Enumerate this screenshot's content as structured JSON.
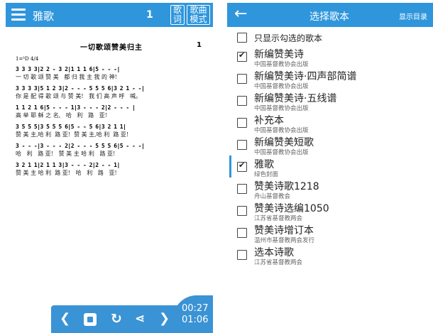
{
  "left": {
    "title": "雅歌",
    "page": "1",
    "lyrics_button": "歌词",
    "mode_button": "歌曲模式",
    "score": {
      "title": "一切歌颂赞美归主",
      "number": "1",
      "key": "1=ᵇD 4/4",
      "rows": [
        {
          "notes": "3 3 3 3|2 2 - 3 2|1 1 1 6|5 - - -|",
          "lyrics": "一 切 歌 颂 赞 美   都 归 我 主 我 的 神!"
        },
        {
          "notes": "3 3 3 3|5 1 2 3|2 - - - 5 5 5 6|3 2 1 - -|",
          "lyrics": "你 是 配 得 歌 颂 与 赞 美!   我 们 高 声 呼   喊。"
        },
        {
          "notes": "1 1 2 1 6|5 - - - 1|3 - - - 2|2 - - - |",
          "lyrics": "高 举 耶 稣 之 名,   哈   利   路   亚!"
        },
        {
          "notes": "3 5 5 5|3 5 5 5 6|5 - - 5 6|3 2 1 1|",
          "lyrics": "赞 美 主,哈 利  路 亚!  赞 美 主,哈 利  路 亚!"
        },
        {
          "notes": "3 - - -|3 - - - 2|2 - - - 5 5 5 6|5 - - -|",
          "lyrics": "哈   利   路 亚!   赞 美 主 哈 利   路 亚!"
        },
        {
          "notes": "3 2 1 1|2 1 1 3|3 - - - 2|2 - - 1|",
          "lyrics": "赞 美 主 哈 利  路 亚!   哈   利   路   亚!"
        }
      ]
    },
    "player": {
      "prev_icon": "❮",
      "loop_icon": "↻",
      "share_icon": "⋖",
      "next_icon": "❯",
      "time_elapsed": "00:27",
      "time_total": "01:06"
    }
  },
  "right": {
    "back_icon": "←",
    "title": "选择歌本",
    "show_catalog": "显示目录",
    "show_checked_only": "只显示勾选的歌本",
    "books": [
      {
        "name": "新编赞美诗",
        "publisher": "中国基督教协会出版",
        "checked": true
      },
      {
        "name": "新编赞美诗·四声部简谱",
        "publisher": "中国基督教协会出版",
        "checked": false
      },
      {
        "name": "新编赞美诗·五线谱",
        "publisher": "中国基督教协会出版",
        "checked": false
      },
      {
        "name": "补充本",
        "publisher": "中国基督教协会出版",
        "checked": false
      },
      {
        "name": "新编赞美短歌",
        "publisher": "中国基督教协会出版",
        "checked": false
      },
      {
        "name": "雅歌",
        "publisher": "绿色封面",
        "checked": true
      },
      {
        "name": "赞美诗歌1218",
        "publisher": "舟山基督教会",
        "checked": false
      },
      {
        "name": "赞美诗选编1050",
        "publisher": "江苏省基督教两会",
        "checked": false
      },
      {
        "name": "赞美诗增订本",
        "publisher": "温州市基督教两会发行",
        "checked": false
      },
      {
        "name": "选本诗歌",
        "publisher": "江苏省基督教两会",
        "checked": false
      }
    ]
  }
}
